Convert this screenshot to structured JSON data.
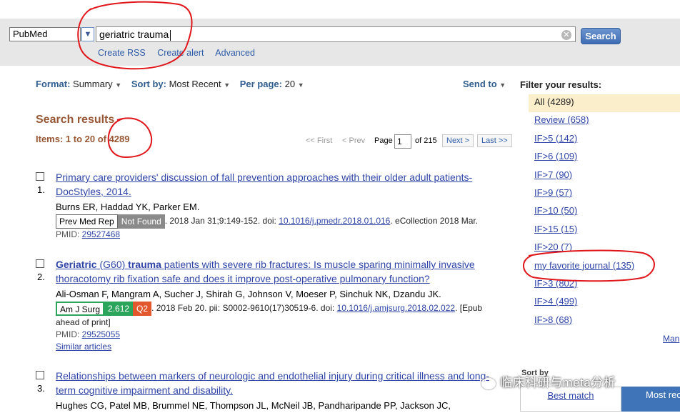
{
  "search": {
    "database": "PubMed",
    "query": "geriatric trauma",
    "clear_symbol": "✕",
    "button": "Search",
    "links": [
      "Create RSS",
      "Create alert",
      "Advanced"
    ]
  },
  "toolbar": {
    "format_label": "Format",
    "format_value": "Summary",
    "sort_label": "Sort by",
    "sort_value": "Most Recent",
    "perpage_label": "Per page",
    "perpage_value": "20",
    "send_to": "Send to"
  },
  "results": {
    "title": "Search results",
    "items_text": "Items: 1 to 20 of 4289"
  },
  "pager": {
    "first": "<< First",
    "prev": "< Prev",
    "page_label": "Page",
    "page_value": "1",
    "of_text": "of 215",
    "next": "Next >",
    "last": "Last >>"
  },
  "items": [
    {
      "number": "1.",
      "title": "Primary care providers' discussion of fall prevention approaches with their older adult patients-DocStyles, 2014.",
      "authors": "Burns ER, Haddad YK, Parker EM.",
      "journal": "Prev Med Rep",
      "status": "Not Found",
      "cite_pre": ". 2018 Jan 31;9:149-152. doi: ",
      "doi": "10.1016/j.pmedr.2018.01.016",
      "cite_post": ". eCollection 2018 Mar.",
      "pmid_label": "PMID: ",
      "pmid": "29527468"
    },
    {
      "number": "2.",
      "title_bold1": "Geriatric",
      "title_mid": " (G60) ",
      "title_bold2": "trauma",
      "title_rest": " patients with severe rib fractures: Is muscle sparing minimally invasive thoracotomy rib fixation safe and does it improve post-operative pulmonary function?",
      "authors": "Ali-Osman F, Mangram A, Sucher J, Shirah G, Johnson V, Moeser P, Sinchuk NK, Dzandu JK.",
      "journal": "Am J Surg",
      "impact": "2.612",
      "quartile": "Q2",
      "cite_pre": ". 2018 Feb 20. pii: S0002-9610(17)30519-6. doi: ",
      "doi": "10.1016/j.amjsurg.2018.02.022",
      "cite_post": ". [Epub ahead of print]",
      "pmid_label": "PMID: ",
      "pmid": "29525055",
      "similar": "Similar articles"
    },
    {
      "number": "3.",
      "title": "Relationships between markers of neurologic and endothelial injury during critical illness and long-term cognitive impairment and disability.",
      "authors": "Hughes CG, Patel MB, Brummel NE, Thompson JL, McNeil JB, Pandharipande PP, Jackson JC,"
    }
  ],
  "sidebar": {
    "heading": "Filter your results:",
    "filters": [
      {
        "label": "All (4289)",
        "active": true
      },
      {
        "label": "Review (658)"
      },
      {
        "label": "IF>5 (142)"
      },
      {
        "label": "IF>6 (109)"
      },
      {
        "label": "IF>7 (90)"
      },
      {
        "label": "IF>9 (57)"
      },
      {
        "label": "IF>10 (50)"
      },
      {
        "label": "IF>15 (15)"
      },
      {
        "label": "IF>20 (7)"
      },
      {
        "label": "my favorite journal (135)"
      },
      {
        "label": "IF>3 (802)"
      },
      {
        "label": "IF>4 (499)"
      },
      {
        "label": "IF>8 (68)"
      }
    ],
    "manage": "Man",
    "sort_by": "Sort by",
    "best_match": "Best match",
    "most_recent": "Most rec"
  },
  "watermark": "临床科研与meta分析",
  "colors": {
    "accent_blue": "#2f45a8",
    "results_brown": "#985735",
    "annotation_red": "#e0161b",
    "if_green": "#2aa55b",
    "quartile_orange": "#e2572b"
  }
}
